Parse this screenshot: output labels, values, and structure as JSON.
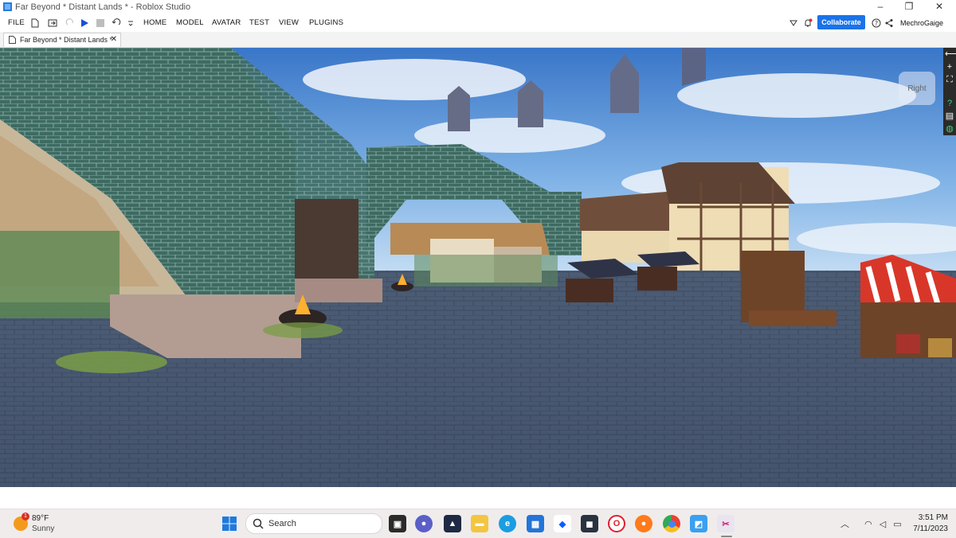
{
  "window": {
    "title": "Far Beyond * Distant Lands * - Roblox Studio",
    "controls": [
      "–",
      "❐",
      "✕"
    ]
  },
  "menubar": {
    "file": "FILE",
    "items": [
      "HOME",
      "MODEL",
      "AVATAR",
      "TEST",
      "VIEW",
      "PLUGINS"
    ],
    "collaborate": "Collaborate",
    "username": "MechroGaige"
  },
  "tab": {
    "label": "Far Beyond * Distant Lands *",
    "close": "✕"
  },
  "viewport": {
    "view_cube_label": "Right",
    "toolbar": [
      "⟵",
      "+",
      "⛶",
      "?",
      "▤",
      "◍"
    ]
  },
  "taskbar": {
    "weather": {
      "temp": "89°F",
      "condition": "Sunny",
      "badge": "1"
    },
    "search_placeholder": "Search",
    "apps": [
      "task-view",
      "chat",
      "terminal",
      "file-explorer",
      "edge",
      "store",
      "dropbox",
      "game",
      "opera",
      "firefox",
      "chrome",
      "roblox-studio",
      "snipping-tool"
    ],
    "clock": {
      "time": "3:51 PM",
      "date": "7/11/2023"
    }
  },
  "colors": {
    "accent": "#1a73e8",
    "taskbar_bg": "#f0ecec"
  }
}
